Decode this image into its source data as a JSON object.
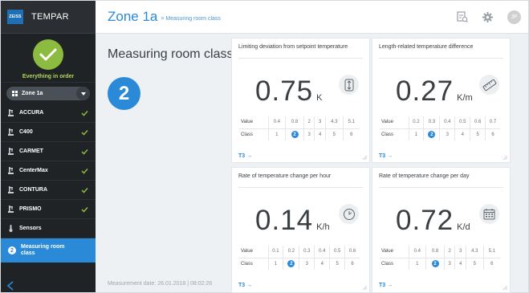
{
  "app": {
    "logo_text": "ZEISS",
    "name": "TEMPAR"
  },
  "status": {
    "text": "Everything in order"
  },
  "zone_selector": {
    "value": "Zone 1a"
  },
  "nav": [
    {
      "label": "ACCURA",
      "ok": true
    },
    {
      "label": "C400",
      "ok": true
    },
    {
      "label": "CARMET",
      "ok": true
    },
    {
      "label": "CenterMax",
      "ok": true
    },
    {
      "label": "CONTURA",
      "ok": true
    },
    {
      "label": "PRISMO",
      "ok": true
    },
    {
      "label": "Sensors",
      "ok": false
    }
  ],
  "nav_active": {
    "badge": "2",
    "label": "Measuring room class"
  },
  "header": {
    "zone": "Zone 1a",
    "breadcrumb": "> Measuring room class",
    "avatar": "JP"
  },
  "main": {
    "title": "Measuring room class",
    "class_value": "2",
    "measurement_date": "Measurement date: 26.01.2018 | 08:02:26"
  },
  "table_labels": {
    "value": "Value",
    "class": "Class",
    "link": "T3 →"
  },
  "cards": [
    {
      "title": "Limiting deviation from setpoint temperature",
      "value": "0.75",
      "unit": "K",
      "icon": "vertical-arrows-icon",
      "values": [
        "0.4",
        "0.8",
        "2",
        "3",
        "4.3",
        "5.1"
      ],
      "classes": [
        "1",
        "2",
        "3",
        "4",
        "5",
        "6"
      ],
      "active_class": "2"
    },
    {
      "title": "Length-related temperature difference",
      "value": "0.27",
      "unit": "K/m",
      "icon": "ruler-icon",
      "values": [
        "0.2",
        "0.3",
        "0.4",
        "0.5",
        "0.6",
        "0.7"
      ],
      "classes": [
        "1",
        "2",
        "3",
        "4",
        "5",
        "6"
      ],
      "active_class": "2"
    },
    {
      "title": "Rate of temperature change per hour",
      "value": "0.14",
      "unit": "K/h",
      "icon": "clock-icon",
      "values": [
        "0.1",
        "0.2",
        "0.3",
        "0.4",
        "0.5",
        "0.6"
      ],
      "classes": [
        "1",
        "2",
        "3",
        "4",
        "5",
        "6"
      ],
      "active_class": "2"
    },
    {
      "title": "Rate of temperature change per day",
      "value": "0.72",
      "unit": "K/d",
      "icon": "calendar-icon",
      "values": [
        "0.4",
        "0.8",
        "2",
        "3",
        "4.3",
        "5.1"
      ],
      "classes": [
        "1",
        "2",
        "3",
        "4",
        "5",
        "6"
      ],
      "active_class": "2"
    }
  ],
  "colors": {
    "accent": "#2a8ad8",
    "ok_green": "#8bbb3f",
    "sidebar_bg": "#202326"
  }
}
